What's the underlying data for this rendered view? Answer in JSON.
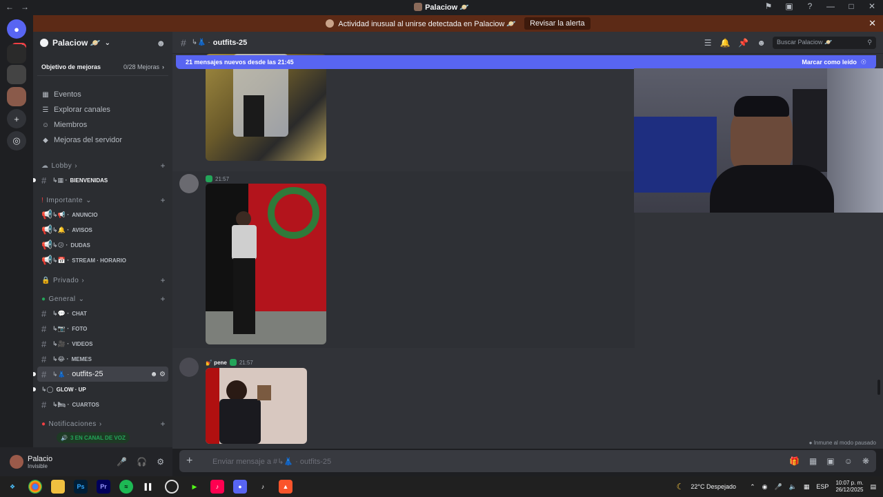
{
  "window": {
    "title": "Palaciow 🪐"
  },
  "servers": {
    "badge": "153"
  },
  "alert": {
    "text": "Actividad inusual al unirse detectada en Palaciow 🪐",
    "button": "Revisar la alerta"
  },
  "sidebar": {
    "server_name": "Palaciow 🪐",
    "boost_goal": "Objetivo de mejoras",
    "boost_count": "0/28 Mejoras",
    "links": [
      "Eventos",
      "Explorar canales",
      "Miembros",
      "Mejoras del servidor"
    ],
    "categories": {
      "lobby": "Lobby",
      "importante": "Importante",
      "privado": "Privado",
      "general": "General",
      "notificaciones": "Notificaciones"
    },
    "channels": {
      "bienvenidas": "BIENVENIDAS",
      "anuncio": "ANUNCIO",
      "avisos": "AVISOS",
      "dudas": "DUDAS",
      "horario": "STREAM · HORARIO",
      "chat": "CHAT",
      "foto": "FOTO",
      "videos": "VIDEOS",
      "memes": "MEMES",
      "outfits": "outfits-25",
      "glowup": "GLOW · UP",
      "cuartos": "CUARTOS"
    },
    "voice_bar": "3 EN CANAL DE VOZ"
  },
  "user": {
    "name": "Palacio",
    "status": "Invisible"
  },
  "channel": {
    "name": "outfits-25",
    "prefix": "↳👗 ·",
    "search_placeholder": "Buscar Palaciow 🪐"
  },
  "chat": {
    "new_messages": "21 mensajes nuevos desde las 21:45",
    "mark_read": "Marcar como leído",
    "messages": [
      {
        "time": "21:57"
      },
      {
        "user": "💅 pene",
        "time": "21:57"
      }
    ],
    "paused_label": "Inmune al modo pausado"
  },
  "composer": {
    "placeholder": "Enviar mensaje a #↳👗 · outfits-25"
  },
  "taskbar": {
    "weather": "22°C  Despejado",
    "lang": "ESP",
    "time": "10:07 p. m.",
    "date": "26/12/2025"
  },
  "colors": {
    "accent": "#5865f2",
    "alert_bg": "#5c2a16",
    "online": "#23a559"
  }
}
